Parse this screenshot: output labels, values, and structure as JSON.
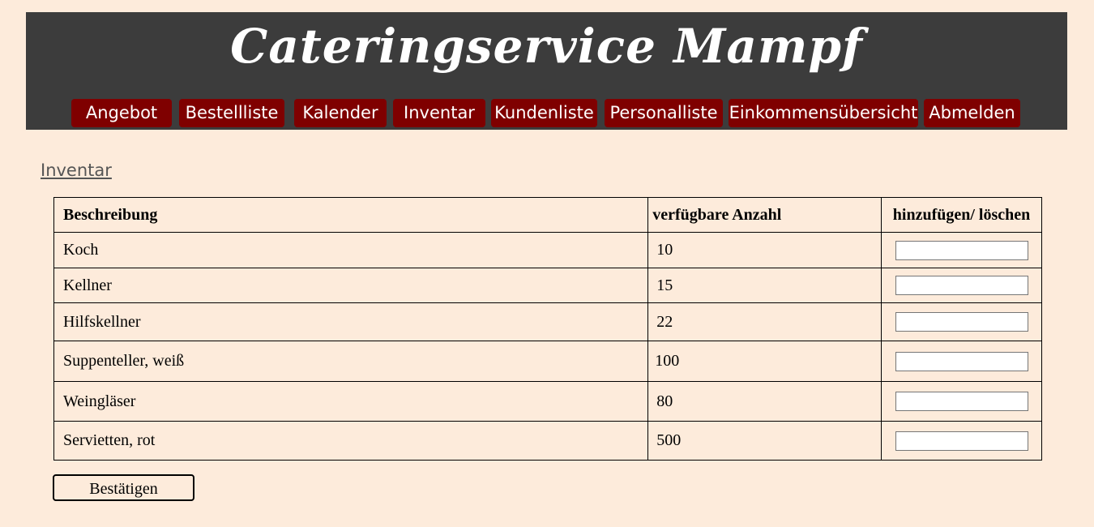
{
  "header": {
    "title": "Cateringservice Mampf",
    "nav": [
      "Angebot",
      "Bestellliste",
      "Kalender",
      "Inventar",
      "Kundenliste",
      "Personalliste",
      "Einkommensübersicht",
      "Abmelden"
    ]
  },
  "section": {
    "title": "Inventar"
  },
  "table": {
    "headers": [
      "Beschreibung",
      "verfügbare Anzahl",
      "hinzufügen/ löschen"
    ],
    "rows": [
      {
        "description": "Koch",
        "count": "10"
      },
      {
        "description": "Kellner",
        "count": "15"
      },
      {
        "description": "Hilfskellner",
        "count": "22"
      },
      {
        "description": "Suppenteller, weiß",
        "count": "100"
      },
      {
        "description": "Weingläser",
        "count": "80"
      },
      {
        "description": "Servietten, rot",
        "count": "500"
      }
    ]
  },
  "form": {
    "confirm_label": "Bestätigen"
  },
  "colors": {
    "background": "#fdebdb",
    "header_bg": "#3c3c3c",
    "nav_bg": "#7f0000",
    "text": "#000000"
  }
}
